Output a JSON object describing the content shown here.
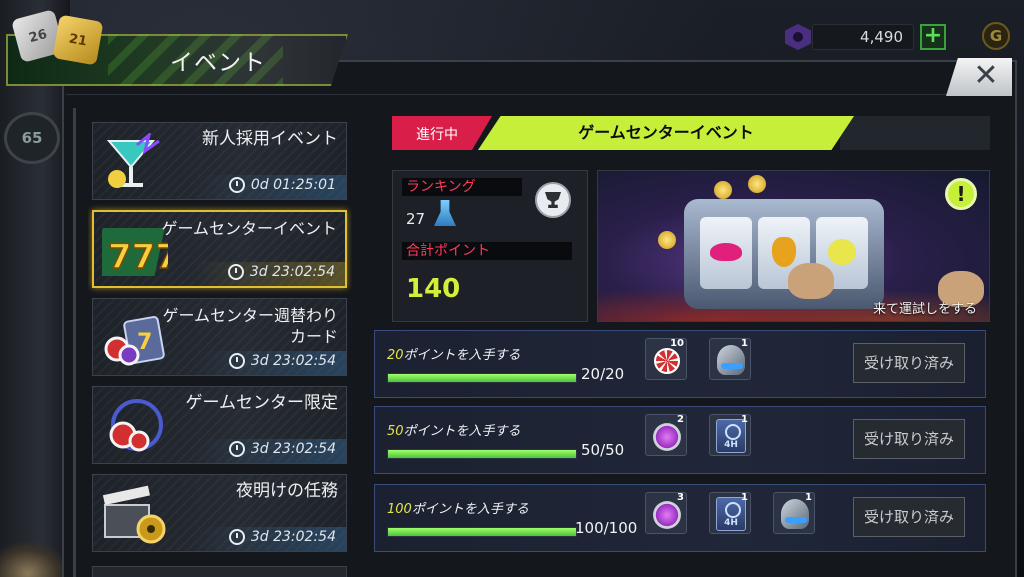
{
  "currency": {
    "amount": "4,490",
    "plus_label": "+",
    "coin_glyph": "G"
  },
  "title": "イベント",
  "dice": {
    "white": "26",
    "gold": "21"
  },
  "close_label": "✕",
  "background": {
    "sign_number": "65"
  },
  "events": [
    {
      "name": "新人採用イベント",
      "timer": "0d 01:25:01"
    },
    {
      "name": "ゲームセンターイベント",
      "timer": "3d 23:02:54"
    },
    {
      "name": "ゲームセンター週替わりカード",
      "timer": "3d 23:02:54"
    },
    {
      "name": "ゲームセンター限定",
      "timer": "3d 23:02:54"
    },
    {
      "name": "夜明けの任務",
      "timer": "3d 23:02:54"
    }
  ],
  "detail": {
    "status": "進行中",
    "header": "ゲームセンターイベント",
    "ranking_label": "ランキング",
    "ranking_value": "27",
    "points_label": "合計ポイント",
    "points_value": "140",
    "banner_caption": "来て運試しをする",
    "alert_glyph": "!"
  },
  "rewards": [
    {
      "points": "20",
      "task_suffix": "ポイントを入手する",
      "progress_text": "20/20",
      "progress": 1.0,
      "items": [
        {
          "icon": "casino-chip-icon",
          "count": "10"
        },
        {
          "icon": "gadget-icon",
          "count": "1"
        }
      ],
      "button": "受け取り済み"
    },
    {
      "points": "50",
      "task_suffix": "ポイントを入手する",
      "progress_text": "50/50",
      "progress": 1.0,
      "items": [
        {
          "icon": "bottle-cap-icon",
          "count": "2"
        },
        {
          "icon": "time-ticket-icon",
          "count": "1",
          "label": "4H"
        }
      ],
      "button": "受け取り済み"
    },
    {
      "points": "100",
      "task_suffix": "ポイントを入手する",
      "progress_text": "100/100",
      "progress": 1.0,
      "items": [
        {
          "icon": "bottle-cap-icon",
          "count": "3"
        },
        {
          "icon": "time-ticket-icon",
          "count": "1",
          "label": "4H"
        },
        {
          "icon": "gadget-icon",
          "count": "1"
        }
      ],
      "button": "受け取り済み"
    }
  ],
  "colors": {
    "accent_green": "#c6ef3a",
    "status_red": "#d91e4a",
    "selected_gold": "#e0c030",
    "progress_green": "#4ec23a"
  }
}
